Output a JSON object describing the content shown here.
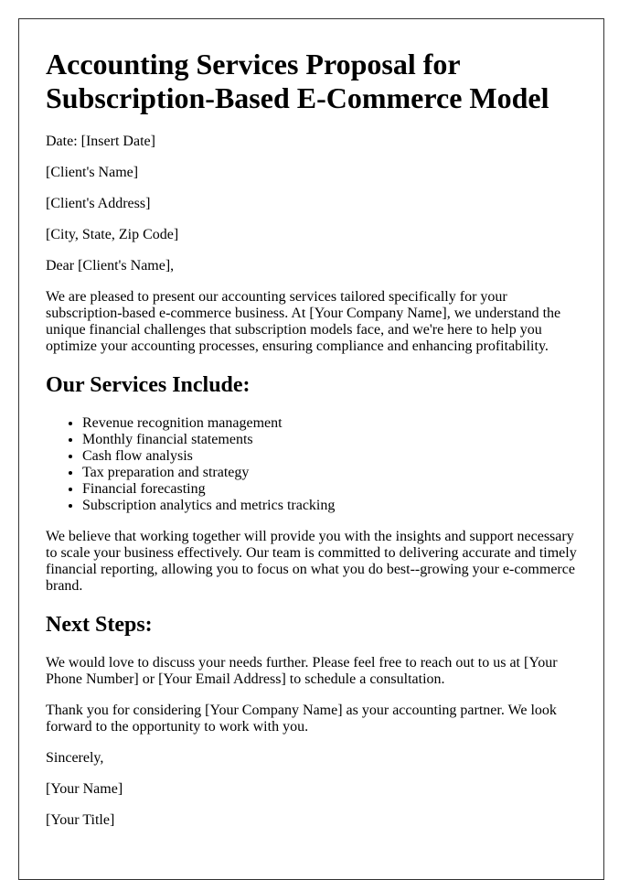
{
  "document": {
    "title": "Accounting Services Proposal for Subscription-Based E-Commerce Model",
    "header_lines": [
      "Date: [Insert Date]",
      "[Client's Name]",
      "[Client's Address]",
      "[City, State, Zip Code]"
    ],
    "salutation": "Dear [Client's Name],",
    "intro_paragraph": "We are pleased to present our accounting services tailored specifically for your subscription-based e-commerce business. At [Your Company Name], we understand the unique financial challenges that subscription models face, and we're here to help you optimize your accounting processes, ensuring compliance and enhancing profitability.",
    "services_heading": "Our Services Include:",
    "services": [
      "Revenue recognition management",
      "Monthly financial statements",
      "Cash flow analysis",
      "Tax preparation and strategy",
      "Financial forecasting",
      "Subscription analytics and metrics tracking"
    ],
    "value_paragraph": "We believe that working together will provide you with the insights and support necessary to scale your business effectively. Our team is committed to delivering accurate and timely financial reporting, allowing you to focus on what you do best--growing your e-commerce brand.",
    "next_steps_heading": "Next Steps:",
    "next_steps_paragraph": "We would love to discuss your needs further. Please feel free to reach out to us at [Your Phone Number] or [Your Email Address] to schedule a consultation.",
    "thanks_paragraph": "Thank you for considering [Your Company Name] as your accounting partner. We look forward to the opportunity to work with you.",
    "closing": "Sincerely,",
    "signature_name": "[Your Name]",
    "signature_title": "[Your Title]"
  }
}
